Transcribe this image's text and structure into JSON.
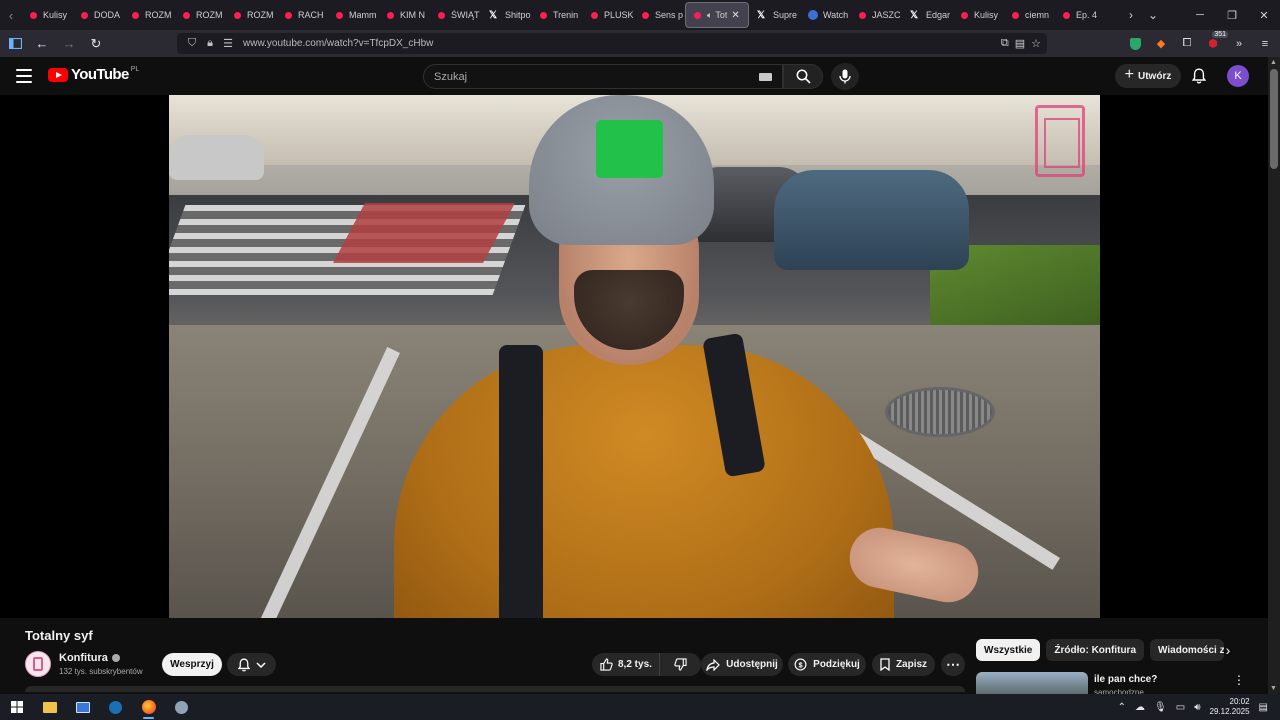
{
  "browser": {
    "tabs": [
      {
        "label": "Kulisy",
        "icon": "youtube-icon"
      },
      {
        "label": "DODA",
        "icon": "youtube-icon"
      },
      {
        "label": "ROZM",
        "icon": "youtube-icon"
      },
      {
        "label": "ROZM",
        "icon": "youtube-icon"
      },
      {
        "label": "ROZM",
        "icon": "youtube-icon"
      },
      {
        "label": "RACH",
        "icon": "youtube-icon"
      },
      {
        "label": "Mamm",
        "icon": "youtube-icon"
      },
      {
        "label": "KIM N",
        "icon": "youtube-icon"
      },
      {
        "label": "ŚWIĄT",
        "icon": "youtube-icon"
      },
      {
        "label": "Shitpo",
        "icon": "x-icon"
      },
      {
        "label": "Trenin",
        "icon": "youtube-icon"
      },
      {
        "label": "PLUSK",
        "icon": "youtube-icon"
      },
      {
        "label": "Sens p",
        "icon": "youtube-icon"
      },
      {
        "label": "Tot",
        "icon": "youtube-icon",
        "active": true
      },
      {
        "label": "Supre",
        "icon": "x-icon"
      },
      {
        "label": "Watch",
        "icon": "web-icon"
      },
      {
        "label": "JASZC",
        "icon": "youtube-icon"
      },
      {
        "label": "Edgar",
        "icon": "x-icon"
      },
      {
        "label": "Kulisy",
        "icon": "youtube-icon"
      },
      {
        "label": "ciemn",
        "icon": "youtube-icon"
      },
      {
        "label": "Ep. 4",
        "icon": "youtube-icon"
      }
    ],
    "url": "www.youtube.com/watch?v=TfcpDX_cHbw",
    "extension_badge": "351"
  },
  "youtube": {
    "logo_text": "YouTube",
    "country_code": "PL",
    "search_placeholder": "Szukaj",
    "create_label": "Utwórz",
    "avatar_letter": "K"
  },
  "video": {
    "title": "Totalny syf",
    "channel_name": "Konfitura",
    "subscribers": "132 tys. subskrybentów",
    "support_label": "Wesprzyj",
    "likes": "8,2 tys.",
    "share_label": "Udostępnij",
    "thanks_label": "Podziękuj",
    "save_label": "Zapisz"
  },
  "sidebar": {
    "chips": [
      "Wszystkie",
      "Źródło: Konfitura",
      "Wiadomości ze świata"
    ],
    "active_chip": "Wszystkie",
    "recommendation": {
      "title": "ile pan chce?",
      "channel": "samochodzne"
    }
  },
  "taskbar": {
    "time": "20:02",
    "date": "29.12.2025"
  },
  "colors": {
    "accent_red": "#ff0000",
    "background": "#0f0f0f",
    "avatar_purple": "#7c4dcf"
  }
}
